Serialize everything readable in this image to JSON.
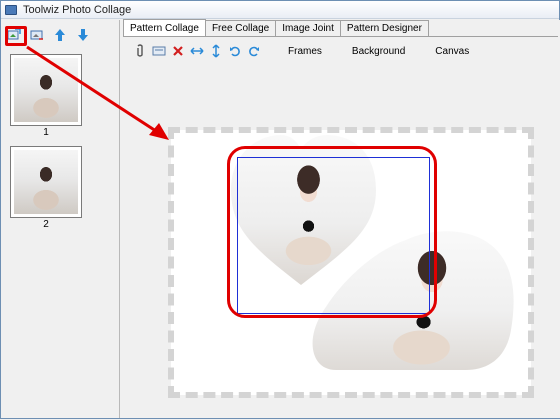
{
  "window": {
    "title": "Toolwiz Photo Collage"
  },
  "left_toolbar": {
    "buttons": [
      {
        "name": "add-photo-icon"
      },
      {
        "name": "remove-photo-icon"
      },
      {
        "name": "move-up-icon"
      },
      {
        "name": "move-down-icon"
      }
    ]
  },
  "thumbnails": [
    {
      "label": "1"
    },
    {
      "label": "2"
    }
  ],
  "tabs": [
    {
      "label": "Pattern Collage",
      "active": true
    },
    {
      "label": "Free Collage"
    },
    {
      "label": "Image Joint"
    },
    {
      "label": "Pattern Designer"
    }
  ],
  "toolbar": {
    "icons": [
      "clip-icon",
      "card-icon",
      "delete-icon",
      "flip-horizontal-icon",
      "flip-vertical-icon",
      "rotate-left-icon",
      "rotate-right-icon"
    ],
    "frames_label": "Frames",
    "background_label": "Background",
    "canvas_label": "Canvas"
  },
  "colors": {
    "highlight": "#e00000",
    "selection": "#1e2fd6",
    "arrow_icon_blue": "#2a8ad8",
    "delete_red": "#d21f1f"
  }
}
